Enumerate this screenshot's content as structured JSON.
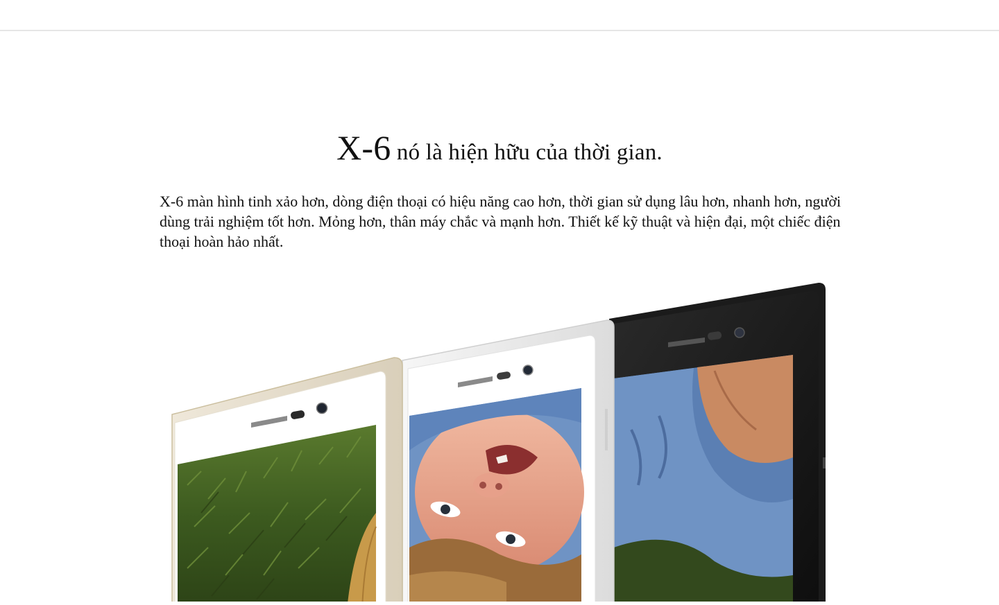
{
  "header": {
    "title": ""
  },
  "section": {
    "headline_model": "X-6",
    "headline_rest": " nó là hiện hữu của thời gian.",
    "description": "X-6 màn hình tinh xảo hơn, dòng điện thoại có hiệu năng cao hơn, thời gian sử dụng lâu hơn, nhanh hơn, người dùng trải nghiệm tốt hơn. Mỏng hơn, thân máy chắc và mạnh hơn. Thiết kế kỹ thuật và hiện đại, một chiếc điện thoại hoàn hảo nhất."
  },
  "colors": {
    "gold_frame": "#e4dccb",
    "white_frame": "#eeeeee",
    "black_frame": "#1c1c1c",
    "grass": "#3f5a22",
    "shirt_blue": "#6f93c4",
    "skin": "#e9a98e"
  },
  "product_image": {
    "phones": [
      "gold-phone",
      "white-phone",
      "black-phone"
    ]
  }
}
